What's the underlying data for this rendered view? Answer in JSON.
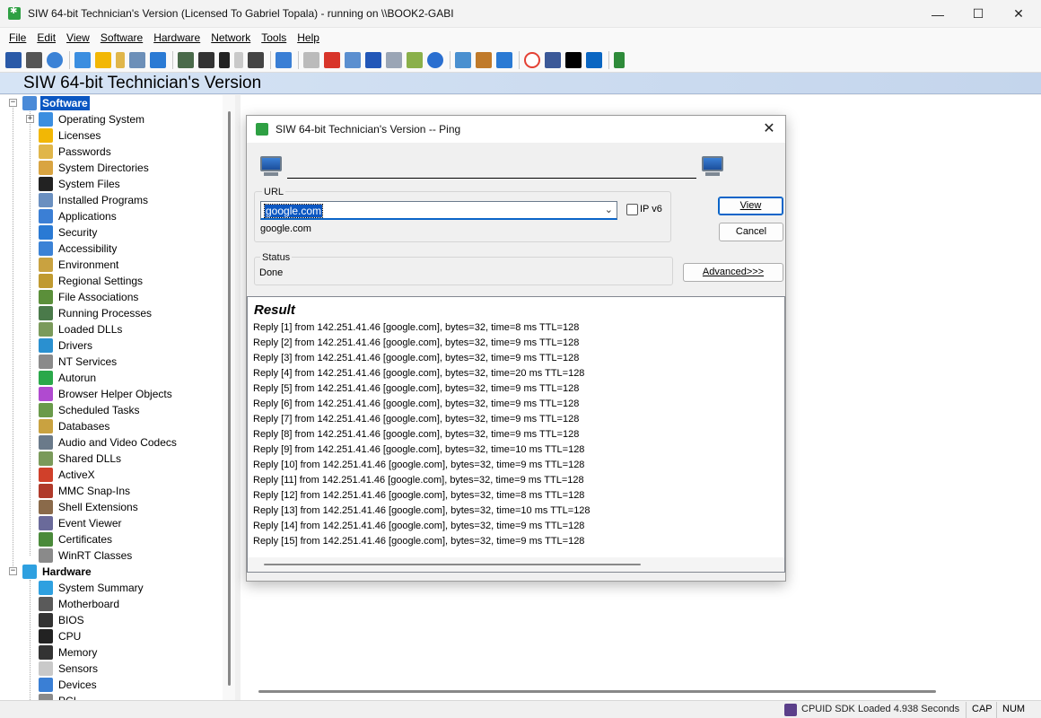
{
  "window": {
    "title": "SIW 64-bit Technician's Version (Licensed To Gabriel Topala) - running on \\\\BOOK2-GABI",
    "minimize": "—",
    "maximize": "☐",
    "close": "✕"
  },
  "menu": [
    {
      "label": "File"
    },
    {
      "label": "Edit"
    },
    {
      "label": "View"
    },
    {
      "label": "Software"
    },
    {
      "label": "Hardware"
    },
    {
      "label": "Network"
    },
    {
      "label": "Tools"
    },
    {
      "label": "Help"
    }
  ],
  "toolbar": {
    "icons": [
      "save-icon",
      "print-icon",
      "refresh-icon",
      "windows-icon",
      "lock-icon",
      "key-icon",
      "report-icon",
      "shield-icon",
      "board-icon",
      "chip-icon",
      "memory-icon",
      "battery-icon",
      "cpu-icon",
      "network-icon",
      "eraser-icon",
      "power-icon",
      "monitor-icon",
      "flag-icon",
      "cards-icon",
      "tools-icon",
      "gear-icon",
      "globe-icon",
      "home-icon",
      "chat-icon",
      "google-icon",
      "facebook-icon",
      "x-icon",
      "linkedin-icon",
      "dollar-icon"
    ]
  },
  "banner": {
    "title": "SIW 64-bit Technician's Version"
  },
  "tree": {
    "software_label": "Software",
    "software_items": [
      "Operating System",
      "Licenses",
      "Passwords",
      "System Directories",
      "System Files",
      "Installed Programs",
      "Applications",
      "Security",
      "Accessibility",
      "Environment",
      "Regional Settings",
      "File Associations",
      "Running Processes",
      "Loaded DLLs",
      "Drivers",
      "NT Services",
      "Autorun",
      "Browser Helper Objects",
      "Scheduled Tasks",
      "Databases",
      "Audio and Video Codecs",
      "Shared DLLs",
      "ActiveX",
      "MMC Snap-Ins",
      "Shell Extensions",
      "Event Viewer",
      "Certificates",
      "WinRT Classes"
    ],
    "hardware_label": "Hardware",
    "hardware_items": [
      "System Summary",
      "Motherboard",
      "BIOS",
      "CPU",
      "Memory",
      "Sensors",
      "Devices",
      "PCI"
    ]
  },
  "dialog": {
    "title": "SIW 64-bit Technician's Version -- Ping",
    "close": "✕",
    "url_group_label": "URL",
    "url_value": "google.com",
    "url_resolved": "google.com",
    "ipv6_label": "IP v6",
    "ipv6_checked": false,
    "view_button": "View",
    "cancel_button": "Cancel",
    "advanced_button": "Advanced>>>",
    "status_group_label": "Status",
    "status_value": "Done",
    "result_title": "Result",
    "replies": [
      "Reply [1] from 142.251.41.46 [google.com], bytes=32, time=8 ms TTL=128",
      "Reply [2] from 142.251.41.46 [google.com], bytes=32, time=9 ms TTL=128",
      "Reply [3] from 142.251.41.46 [google.com], bytes=32, time=9 ms TTL=128",
      "Reply [4] from 142.251.41.46 [google.com], bytes=32, time=20 ms TTL=128",
      "Reply [5] from 142.251.41.46 [google.com], bytes=32, time=9 ms TTL=128",
      "Reply [6] from 142.251.41.46 [google.com], bytes=32, time=9 ms TTL=128",
      "Reply [7] from 142.251.41.46 [google.com], bytes=32, time=9 ms TTL=128",
      "Reply [8] from 142.251.41.46 [google.com], bytes=32, time=9 ms TTL=128",
      "Reply [9] from 142.251.41.46 [google.com], bytes=32, time=10 ms TTL=128",
      "Reply [10] from 142.251.41.46 [google.com], bytes=32, time=9 ms TTL=128",
      "Reply [11] from 142.251.41.46 [google.com], bytes=32, time=9 ms TTL=128",
      "Reply [12] from 142.251.41.46 [google.com], bytes=32, time=8 ms TTL=128",
      "Reply [13] from 142.251.41.46 [google.com], bytes=32, time=10 ms TTL=128",
      "Reply [14] from 142.251.41.46 [google.com], bytes=32, time=9 ms TTL=128",
      "Reply [15] from 142.251.41.46 [google.com], bytes=32, time=9 ms TTL=128"
    ]
  },
  "statusbar": {
    "sdk_text": "CPUID SDK Loaded 4.938 Seconds",
    "cap": "CAP",
    "num": "NUM"
  },
  "colors": {
    "selection": "#0b57c2",
    "banner": "#c4d5ec",
    "app_icon": "#2ea043"
  }
}
